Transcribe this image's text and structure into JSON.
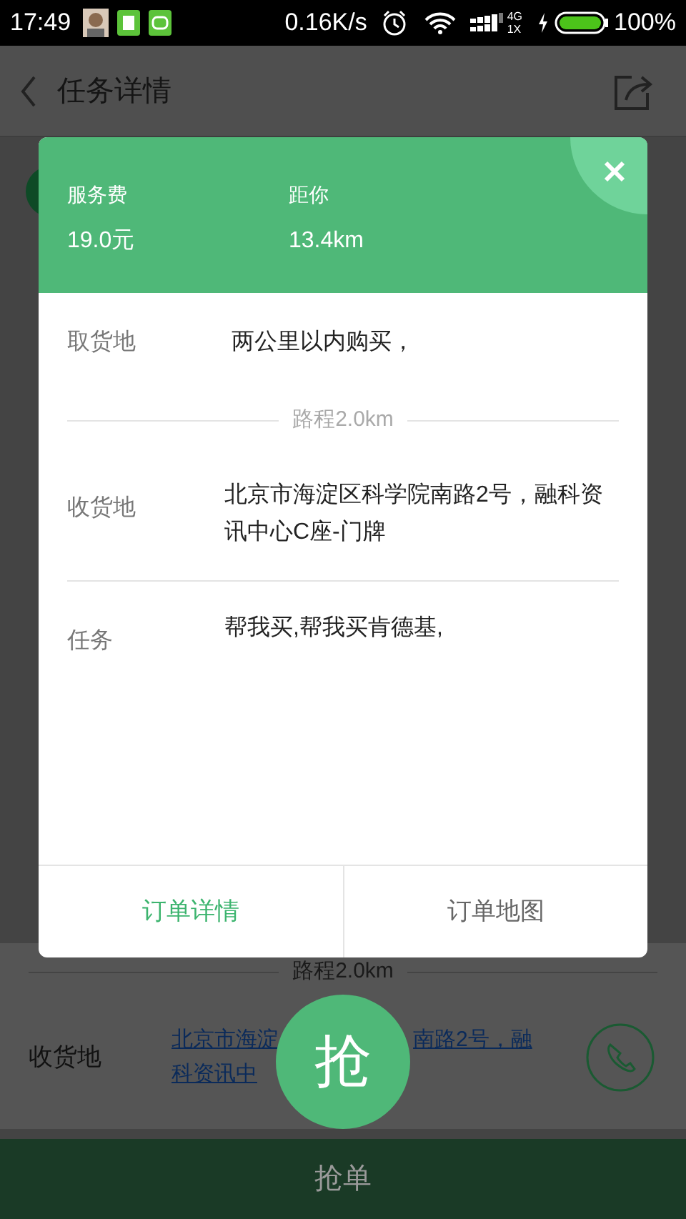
{
  "status_bar": {
    "time": "17:49",
    "speed": "0.16K/s",
    "network_top": "4G",
    "network_bottom": "1X",
    "battery": "100%"
  },
  "header": {
    "title": "任务详情"
  },
  "page": {
    "route": "路程2.0km",
    "delivery": {
      "label": "收货地",
      "link_parts": [
        "北京市海淀",
        "南路2号，融",
        "科资讯中"
      ]
    },
    "grab_button": "抢",
    "bottom_button": "抢单"
  },
  "dialog": {
    "stats": [
      {
        "label": "服务费",
        "value": "19.0元"
      },
      {
        "label": "距你",
        "value": "13.4km"
      }
    ],
    "rows": [
      {
        "kind": "field",
        "label": "取货地",
        "value": "两公里以内购买，"
      },
      {
        "kind": "route",
        "text": "路程2.0km"
      },
      {
        "kind": "field",
        "label": "收货地",
        "value": "北京市海淀区科学院南路2号，融科资讯中心C座-门牌"
      },
      {
        "kind": "field",
        "label": "任务",
        "value": "帮我买,帮我买肯德基,"
      }
    ],
    "actions": [
      {
        "label": "订单详情",
        "selected": true
      },
      {
        "label": "订单地图",
        "selected": false
      }
    ]
  }
}
